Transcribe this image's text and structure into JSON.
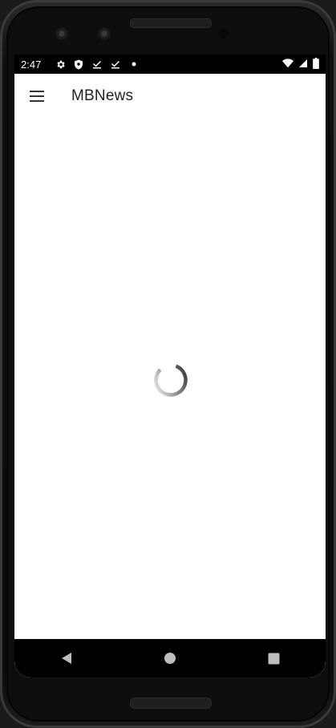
{
  "status_bar": {
    "time": "2:47",
    "left_icons": [
      "settings-icon",
      "shield-icon",
      "download-done-icon",
      "download-done-icon",
      "dot-icon"
    ],
    "right_icons": [
      "wifi-icon",
      "signal-icon",
      "battery-icon"
    ]
  },
  "app_bar": {
    "menu_icon": "menu-icon",
    "title": "MBNews"
  },
  "content": {
    "loading_indicator": "progress-spinner"
  },
  "nav_bar": {
    "buttons": [
      "back-icon",
      "home-icon",
      "recents-icon"
    ]
  },
  "colors": {
    "background": "#ffffff",
    "bars": "#000000",
    "title_text": "#222222",
    "spinner": "#333333"
  }
}
